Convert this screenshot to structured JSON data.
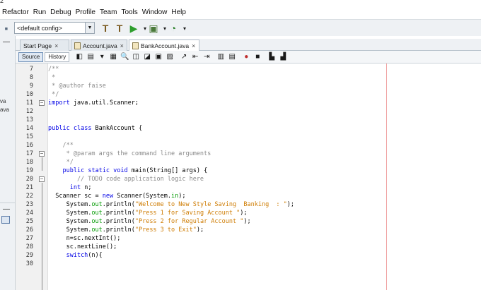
{
  "window": {
    "title_fragment": "2"
  },
  "menu": [
    "Refactor",
    "Run",
    "Debug",
    "Profile",
    "Team",
    "Tools",
    "Window",
    "Help"
  ],
  "toolbar": {
    "config_value": "<default config>"
  },
  "left_panel": {
    "label_top": "va",
    "label_bottom": "ava"
  },
  "tabs": [
    {
      "label": "Start Page",
      "active": false
    },
    {
      "label": "Account.java",
      "active": false
    },
    {
      "label": "BankAccount.java",
      "active": true
    }
  ],
  "editor_toolbar": {
    "source_label": "Source",
    "history_label": "History"
  },
  "code_lines": [
    {
      "n": "7",
      "text": "/**"
    },
    {
      "n": "8",
      "text": " *"
    },
    {
      "n": "9",
      "text": " * @author faise"
    },
    {
      "n": "10",
      "text": " */"
    },
    {
      "n": "11",
      "text": "import java.util.Scanner;"
    },
    {
      "n": "12",
      "text": ""
    },
    {
      "n": "13",
      "text": ""
    },
    {
      "n": "14",
      "text": "public class BankAccount {"
    },
    {
      "n": "15",
      "text": ""
    },
    {
      "n": "16",
      "text": "    /**"
    },
    {
      "n": "17",
      "text": "     * @param args the command line arguments"
    },
    {
      "n": "18",
      "text": "     */"
    },
    {
      "n": "19",
      "text": "    public static void main(String[] args) {"
    },
    {
      "n": "20",
      "text": "        // TODO code application logic here"
    },
    {
      "n": "21",
      "text": "      int n;"
    },
    {
      "n": "22",
      "text": "  Scanner sc = new Scanner(System.in);"
    },
    {
      "n": "23",
      "text": "     System.out.println(\"Welcome to New Style Saving  Banking  : \");"
    },
    {
      "n": "24",
      "text": "     System.out.println(\"Press 1 for Saving Account \");"
    },
    {
      "n": "25",
      "text": "     System.out.println(\"Press 2 for Regular Account \");"
    },
    {
      "n": "26",
      "text": "     System.out.println(\"Press 3 to Exit\");"
    },
    {
      "n": "27",
      "text": "     n=sc.nextInt();"
    },
    {
      "n": "28",
      "text": "     sc.nextLine();"
    },
    {
      "n": "29",
      "text": "     switch(n){"
    },
    {
      "n": "30",
      "text": ""
    }
  ],
  "colors": {
    "keyword": "#0000e6",
    "string": "#ce7b00",
    "comment": "#8a8a8a",
    "field": "#009900",
    "margin_line": "#f0a0a0"
  }
}
